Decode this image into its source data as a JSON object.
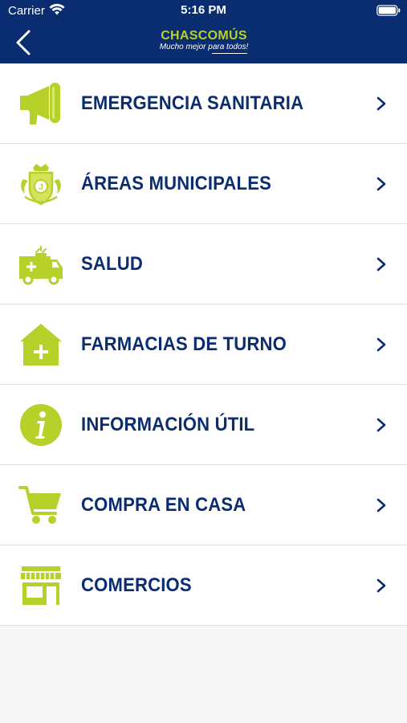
{
  "status_bar": {
    "carrier": "Carrier",
    "time": "5:16 PM"
  },
  "header": {
    "logo_title": "CHASCOMÚS",
    "logo_tagline": "Mucho mejor para todos!"
  },
  "menu": {
    "items": [
      {
        "label": "EMERGENCIA SANITARIA",
        "icon": "megaphone-icon"
      },
      {
        "label": "ÁREAS MUNICIPALES",
        "icon": "municipal-crest-icon"
      },
      {
        "label": "SALUD",
        "icon": "ambulance-icon"
      },
      {
        "label": "FARMACIAS DE TURNO",
        "icon": "pharmacy-icon"
      },
      {
        "label": "INFORMACIÓN ÚTIL",
        "icon": "info-icon"
      },
      {
        "label": "COMPRA EN CASA",
        "icon": "shopping-cart-icon"
      },
      {
        "label": "COMERCIOS",
        "icon": "storefront-icon"
      }
    ]
  },
  "colors": {
    "header_bg": "#0a2d72",
    "accent": "#b8d02a",
    "label": "#0a2d72"
  }
}
